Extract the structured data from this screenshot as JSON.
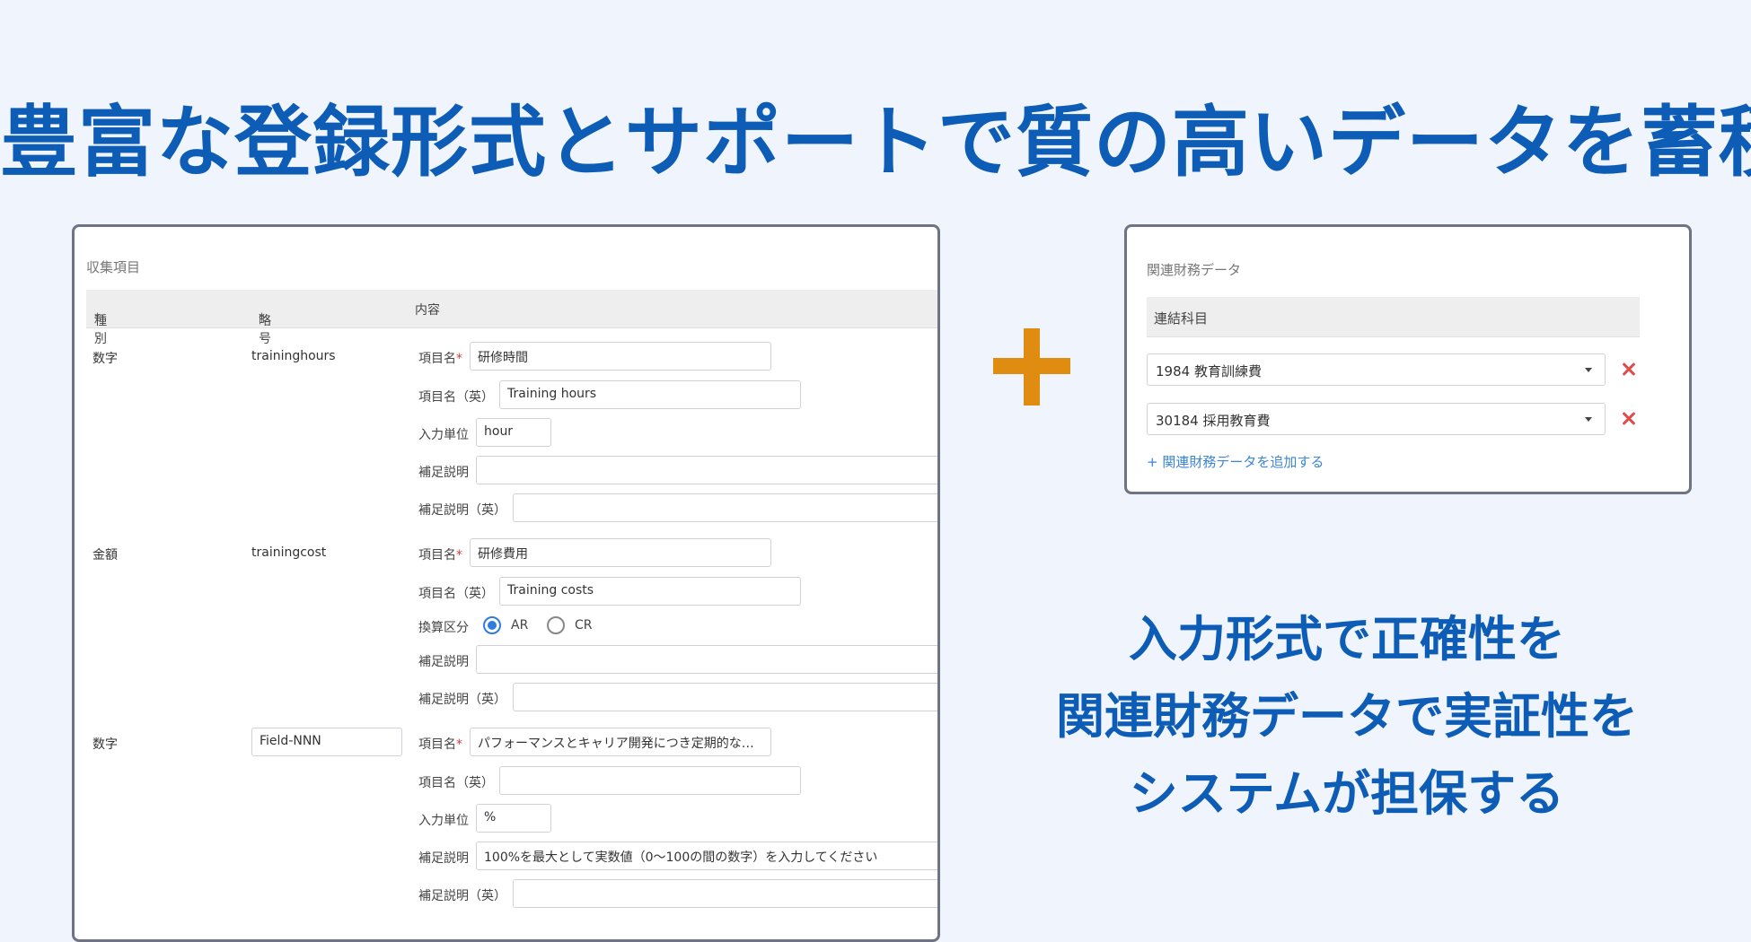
{
  "headline": "豊富な登録形式とサポートで質の高いデータを蓄積",
  "form_panel": {
    "title": "収集項目",
    "headers": {
      "type": "種別",
      "code": "略号",
      "content": "内容",
      "required_mark": "*"
    },
    "labels": {
      "name": "項目名",
      "name_en": "項目名（英）",
      "unit": "入力単位",
      "note": "補足説明",
      "note_en": "補足説明（英）",
      "conversion": "換算区分"
    },
    "fields": [
      {
        "type": "数字",
        "code": "traininghours",
        "name": "研修時間",
        "name_en": "Training hours",
        "unit": "hour",
        "note": "",
        "note_en": ""
      },
      {
        "type": "金額",
        "code": "trainingcost",
        "name": "研修費用",
        "name_en": "Training costs",
        "conversion_options": [
          "AR",
          "CR"
        ],
        "conversion_selected": "AR",
        "note": "",
        "note_en": ""
      },
      {
        "type": "数字",
        "code": "Field-NNN",
        "name": "パフォーマンスとキャリア開発につき定期的なレ...",
        "name_en": "",
        "unit": "%",
        "note": "100%を最大として実数値（0〜100の間の数字）を入力してください",
        "note_en": ""
      }
    ]
  },
  "financial_panel": {
    "title": "関連財務データ",
    "header": "連結科目",
    "items": [
      "1984 教育訓練費",
      "30184 採用教育費"
    ],
    "add_label": "+ 関連財務データを追加する"
  },
  "tagline": [
    "入力形式で正確性を",
    "関連財務データで実証性を",
    "システムが担保する"
  ],
  "colors": {
    "accent": "#0d5cb6",
    "plus": "#df8c10",
    "delete": "#e24b4b",
    "link": "#3d86d9",
    "radio": "#2f7de1"
  }
}
